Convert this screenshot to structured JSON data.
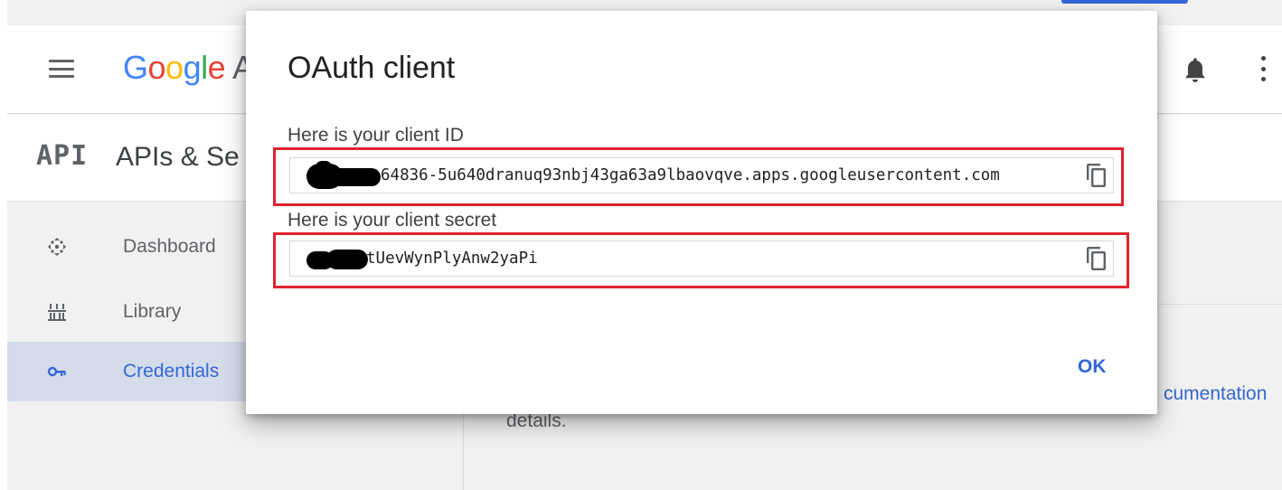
{
  "header": {
    "menu_icon": "hamburger-menu-icon",
    "logo_text": "Google",
    "logo_rest": "A",
    "logo_colors": [
      "#4285f4",
      "#ea4335",
      "#fbbc05",
      "#4285f4",
      "#34a853",
      "#ea4335"
    ],
    "accent_color": "#3367d6",
    "notification_icon": "bell-icon",
    "more_icon": "more-vertical-icon"
  },
  "api_bar": {
    "badge": "API",
    "title": "APIs & Se"
  },
  "sidebar": {
    "items": [
      {
        "label": "Dashboard",
        "icon": "dashboard-icon",
        "active": false
      },
      {
        "label": "Library",
        "icon": "library-icon",
        "active": false
      },
      {
        "label": "Credentials",
        "icon": "key-icon",
        "active": true
      }
    ]
  },
  "content": {
    "doc_link": "cumentation",
    "details_text": "details."
  },
  "dialog": {
    "title": "OAuth client",
    "client_id_label": "Here is your client ID",
    "client_id_value": "64836-5u640dranuq93nbj43ga63a9lbaovqve.apps.googleusercontent.com",
    "client_secret_label": "Here is your client secret",
    "client_secret_value": "tUevWynPlyAnw2yaPi",
    "copy_icon": "copy-icon",
    "highlight_color": "#e0232e",
    "ok_label": "OK"
  }
}
